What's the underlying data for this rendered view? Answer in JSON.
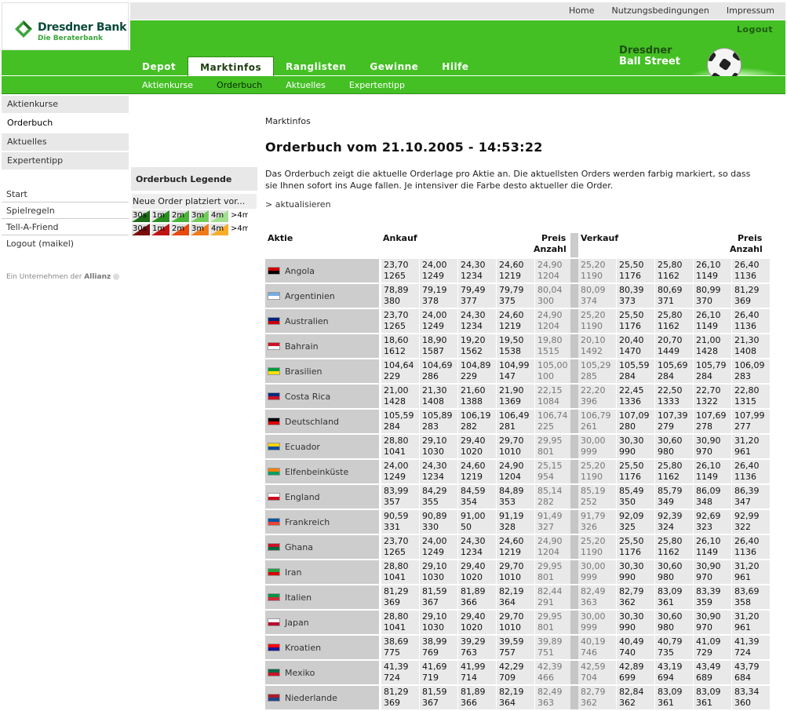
{
  "top_links": [
    "Home",
    "Nutzungsbedingungen",
    "Impressum"
  ],
  "logo": {
    "name": "Dresdner Bank",
    "tagline": "Die Beraterbank"
  },
  "logout": "Logout",
  "brand": {
    "line1": "Dresdner",
    "line2": "Ball Street"
  },
  "main_nav": [
    "Depot",
    "Marktinfos",
    "Ranglisten",
    "Gewinne",
    "Hilfe"
  ],
  "main_nav_active": "Marktinfos",
  "sub_nav": [
    "Aktienkurse",
    "Orderbuch",
    "Aktuelles",
    "Expertentipp"
  ],
  "sub_nav_active": "Orderbuch",
  "left_nav": [
    "Aktienkurse",
    "Orderbuch",
    "Aktuelles",
    "Expertentipp"
  ],
  "left_nav_active": "Orderbuch",
  "left_nav2": [
    "Start",
    "Spielregeln",
    "Tell-A-Friend",
    "Logout (maikel)"
  ],
  "allianz": {
    "prefix": "Ein Unternehmen der",
    "name": "Allianz"
  },
  "legend": {
    "title": "Orderbuch Legende",
    "text": "Neue Order platziert vor...",
    "labels": [
      "30s",
      "1m",
      "2m",
      "3m",
      "4m",
      ">4m"
    ],
    "buy_colors": [
      "#1d6e17",
      "#2a8f20",
      "#49b53a",
      "#72cc5c",
      "#a2df8f",
      "#ffffff"
    ],
    "sell_colors": [
      "#7a0c0c",
      "#c01515",
      "#e8490f",
      "#f07a1a",
      "#f7ad2a",
      "#ffffff"
    ]
  },
  "breadcrumb": "Marktinfos",
  "page_title": "Orderbuch vom 21.10.2005 - 14:53:22",
  "description": "Das Orderbuch zeigt die aktuelle Orderlage pro Aktie an. Die aktuellsten Orders werden farbig markiert, so dass sie Ihnen sofort ins Auge fallen. Je intensiver die Farbe desto aktueller die Order.",
  "refresh": "> aktualisieren",
  "table_headers": {
    "aktie": "Aktie",
    "ankauf": "Ankauf",
    "verkauf": "Verkauf",
    "preis": "Preis",
    "anzahl": "Anzahl"
  },
  "rows": [
    {
      "country": "Angola",
      "flag": [
        "#cc0000",
        "#000000"
      ],
      "buy": [
        [
          "23,70",
          "1265"
        ],
        [
          "24,00",
          "1249"
        ],
        [
          "24,30",
          "1234"
        ],
        [
          "24,60",
          "1219"
        ],
        [
          "24,90",
          "1204"
        ]
      ],
      "sell": [
        [
          "25,20",
          "1190"
        ],
        [
          "25,50",
          "1176"
        ],
        [
          "25,80",
          "1162"
        ],
        [
          "26,10",
          "1149"
        ],
        [
          "26,40",
          "1136"
        ]
      ]
    },
    {
      "country": "Argentinien",
      "flag": [
        "#74acdf",
        "#ffffff"
      ],
      "buy": [
        [
          "78,89",
          "380"
        ],
        [
          "79,19",
          "378"
        ],
        [
          "79,49",
          "377"
        ],
        [
          "79,79",
          "375"
        ],
        [
          "80,04",
          "300"
        ]
      ],
      "sell": [
        [
          "80,09",
          "374"
        ],
        [
          "80,39",
          "373"
        ],
        [
          "80,69",
          "371"
        ],
        [
          "80,99",
          "370"
        ],
        [
          "81,29",
          "369"
        ]
      ]
    },
    {
      "country": "Australien",
      "flag": [
        "#00247d",
        "#cc0000"
      ],
      "buy": [
        [
          "23,70",
          "1265"
        ],
        [
          "24,00",
          "1249"
        ],
        [
          "24,30",
          "1234"
        ],
        [
          "24,60",
          "1219"
        ],
        [
          "24,90",
          "1204"
        ]
      ],
      "sell": [
        [
          "25,20",
          "1190"
        ],
        [
          "25,50",
          "1176"
        ],
        [
          "25,80",
          "1162"
        ],
        [
          "26,10",
          "1149"
        ],
        [
          "26,40",
          "1136"
        ]
      ]
    },
    {
      "country": "Bahrain",
      "flag": [
        "#ce1126",
        "#ffffff"
      ],
      "buy": [
        [
          "18,60",
          "1612"
        ],
        [
          "18,90",
          "1587"
        ],
        [
          "19,20",
          "1562"
        ],
        [
          "19,50",
          "1538"
        ],
        [
          "19,80",
          "1515"
        ]
      ],
      "sell": [
        [
          "20,10",
          "1492"
        ],
        [
          "20,40",
          "1470"
        ],
        [
          "20,70",
          "1449"
        ],
        [
          "21,00",
          "1428"
        ],
        [
          "21,30",
          "1408"
        ]
      ]
    },
    {
      "country": "Brasilien",
      "flag": [
        "#009c3b",
        "#ffdf00"
      ],
      "buy": [
        [
          "104,64",
          "229"
        ],
        [
          "104,69",
          "286"
        ],
        [
          "104,89",
          "229"
        ],
        [
          "104,99",
          "147"
        ],
        [
          "105,00",
          "100"
        ]
      ],
      "sell": [
        [
          "105,29",
          "285"
        ],
        [
          "105,59",
          "284"
        ],
        [
          "105,69",
          "284"
        ],
        [
          "105,79",
          "284"
        ],
        [
          "106,09",
          "283"
        ]
      ]
    },
    {
      "country": "Costa Rica",
      "flag": [
        "#002b7f",
        "#ce1126"
      ],
      "buy": [
        [
          "21,00",
          "1428"
        ],
        [
          "21,30",
          "1408"
        ],
        [
          "21,60",
          "1388"
        ],
        [
          "21,90",
          "1369"
        ],
        [
          "22,15",
          "1084"
        ]
      ],
      "sell": [
        [
          "22,20",
          "396"
        ],
        [
          "22,45",
          "1336"
        ],
        [
          "22,50",
          "1333"
        ],
        [
          "22,70",
          "1322"
        ],
        [
          "22,80",
          "1315"
        ]
      ]
    },
    {
      "country": "Deutschland",
      "flag": [
        "#000000",
        "#dd0000"
      ],
      "buy": [
        [
          "105,59",
          "284"
        ],
        [
          "105,89",
          "283"
        ],
        [
          "106,19",
          "282"
        ],
        [
          "106,49",
          "281"
        ],
        [
          "106,74",
          "225"
        ]
      ],
      "sell": [
        [
          "106,79",
          "261"
        ],
        [
          "107,09",
          "280"
        ],
        [
          "107,39",
          "279"
        ],
        [
          "107,69",
          "278"
        ],
        [
          "107,99",
          "277"
        ]
      ]
    },
    {
      "country": "Ecuador",
      "flag": [
        "#ffd100",
        "#034ea2"
      ],
      "buy": [
        [
          "28,80",
          "1041"
        ],
        [
          "29,10",
          "1030"
        ],
        [
          "29,40",
          "1020"
        ],
        [
          "29,70",
          "1010"
        ],
        [
          "29,95",
          "801"
        ]
      ],
      "sell": [
        [
          "30,00",
          "999"
        ],
        [
          "30,30",
          "990"
        ],
        [
          "30,60",
          "980"
        ],
        [
          "30,90",
          "970"
        ],
        [
          "31,20",
          "961"
        ]
      ]
    },
    {
      "country": "Elfenbeinküste",
      "flag": [
        "#f77f00",
        "#009e60"
      ],
      "buy": [
        [
          "24,00",
          "1249"
        ],
        [
          "24,30",
          "1234"
        ],
        [
          "24,60",
          "1219"
        ],
        [
          "24,90",
          "1204"
        ],
        [
          "25,15",
          "954"
        ]
      ],
      "sell": [
        [
          "25,20",
          "1190"
        ],
        [
          "25,50",
          "1176"
        ],
        [
          "25,80",
          "1162"
        ],
        [
          "26,10",
          "1149"
        ],
        [
          "26,40",
          "1136"
        ]
      ]
    },
    {
      "country": "England",
      "flag": [
        "#ffffff",
        "#cf081f"
      ],
      "buy": [
        [
          "83,99",
          "357"
        ],
        [
          "84,29",
          "355"
        ],
        [
          "84,59",
          "354"
        ],
        [
          "84,89",
          "353"
        ],
        [
          "85,14",
          "282"
        ]
      ],
      "sell": [
        [
          "85,19",
          "252"
        ],
        [
          "85,49",
          "350"
        ],
        [
          "85,79",
          "349"
        ],
        [
          "86,09",
          "348"
        ],
        [
          "86,39",
          "347"
        ]
      ]
    },
    {
      "country": "Frankreich",
      "flag": [
        "#0055a4",
        "#ef4135"
      ],
      "buy": [
        [
          "90,59",
          "331"
        ],
        [
          "90,89",
          "330"
        ],
        [
          "91,00",
          "50"
        ],
        [
          "91,19",
          "328"
        ],
        [
          "91,49",
          "327"
        ]
      ],
      "sell": [
        [
          "91,79",
          "326"
        ],
        [
          "92,09",
          "325"
        ],
        [
          "92,39",
          "324"
        ],
        [
          "92,69",
          "323"
        ],
        [
          "92,99",
          "322"
        ]
      ]
    },
    {
      "country": "Ghana",
      "flag": [
        "#ce1126",
        "#006b3f"
      ],
      "buy": [
        [
          "23,70",
          "1265"
        ],
        [
          "24,00",
          "1249"
        ],
        [
          "24,30",
          "1234"
        ],
        [
          "24,60",
          "1219"
        ],
        [
          "24,90",
          "1204"
        ]
      ],
      "sell": [
        [
          "25,20",
          "1190"
        ],
        [
          "25,50",
          "1176"
        ],
        [
          "25,80",
          "1162"
        ],
        [
          "26,10",
          "1149"
        ],
        [
          "26,40",
          "1136"
        ]
      ]
    },
    {
      "country": "Iran",
      "flag": [
        "#239f40",
        "#da0000"
      ],
      "buy": [
        [
          "28,80",
          "1041"
        ],
        [
          "29,10",
          "1030"
        ],
        [
          "29,40",
          "1020"
        ],
        [
          "29,70",
          "1010"
        ],
        [
          "29,95",
          "801"
        ]
      ],
      "sell": [
        [
          "30,00",
          "999"
        ],
        [
          "30,30",
          "990"
        ],
        [
          "30,60",
          "980"
        ],
        [
          "30,90",
          "970"
        ],
        [
          "31,20",
          "961"
        ]
      ]
    },
    {
      "country": "Italien",
      "flag": [
        "#009246",
        "#ce2b37"
      ],
      "buy": [
        [
          "81,29",
          "369"
        ],
        [
          "81,59",
          "367"
        ],
        [
          "81,89",
          "366"
        ],
        [
          "82,19",
          "364"
        ],
        [
          "82,44",
          "291"
        ]
      ],
      "sell": [
        [
          "82,49",
          "363"
        ],
        [
          "82,79",
          "362"
        ],
        [
          "83,09",
          "361"
        ],
        [
          "83,39",
          "359"
        ],
        [
          "83,69",
          "358"
        ]
      ]
    },
    {
      "country": "Japan",
      "flag": [
        "#ffffff",
        "#bc002d"
      ],
      "buy": [
        [
          "28,80",
          "1041"
        ],
        [
          "29,10",
          "1030"
        ],
        [
          "29,40",
          "1020"
        ],
        [
          "29,70",
          "1010"
        ],
        [
          "29,95",
          "801"
        ]
      ],
      "sell": [
        [
          "30,00",
          "999"
        ],
        [
          "30,30",
          "990"
        ],
        [
          "30,60",
          "980"
        ],
        [
          "30,90",
          "970"
        ],
        [
          "31,20",
          "961"
        ]
      ]
    },
    {
      "country": "Kroatien",
      "flag": [
        "#ff0000",
        "#171796"
      ],
      "buy": [
        [
          "38,69",
          "775"
        ],
        [
          "38,99",
          "769"
        ],
        [
          "39,29",
          "763"
        ],
        [
          "39,59",
          "757"
        ],
        [
          "39,89",
          "751"
        ]
      ],
      "sell": [
        [
          "40,19",
          "746"
        ],
        [
          "40,49",
          "740"
        ],
        [
          "40,79",
          "735"
        ],
        [
          "41,09",
          "729"
        ],
        [
          "41,39",
          "724"
        ]
      ]
    },
    {
      "country": "Mexiko",
      "flag": [
        "#006847",
        "#ce1126"
      ],
      "buy": [
        [
          "41,39",
          "724"
        ],
        [
          "41,69",
          "719"
        ],
        [
          "41,99",
          "714"
        ],
        [
          "42,29",
          "709"
        ],
        [
          "42,39",
          "466"
        ]
      ],
      "sell": [
        [
          "42,59",
          "704"
        ],
        [
          "42,89",
          "699"
        ],
        [
          "43,19",
          "694"
        ],
        [
          "43,49",
          "689"
        ],
        [
          "43,79",
          "684"
        ]
      ]
    },
    {
      "country": "Niederlande",
      "flag": [
        "#ae1c28",
        "#21468b"
      ],
      "buy": [
        [
          "81,29",
          "369"
        ],
        [
          "81,59",
          "367"
        ],
        [
          "81,89",
          "366"
        ],
        [
          "82,19",
          "364"
        ],
        [
          "82,49",
          "363"
        ]
      ],
      "sell": [
        [
          "82,79",
          "362"
        ],
        [
          "82,84",
          "362"
        ],
        [
          "83,09",
          "361"
        ],
        [
          "83,09",
          "361"
        ],
        [
          "83,34",
          "360"
        ]
      ]
    }
  ]
}
